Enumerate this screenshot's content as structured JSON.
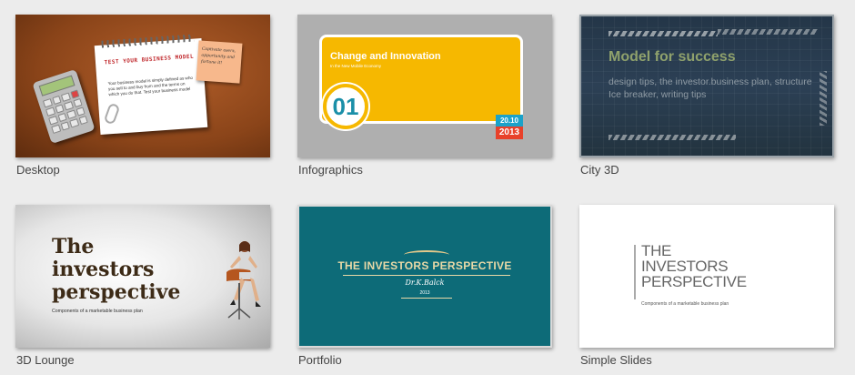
{
  "templates": [
    {
      "name": "Desktop",
      "notepad_title": "TEST YOUR BUSINESS MODEL",
      "notepad_body": "Your business model is simply defined as who you sell to and buy from and the terms on which you do that. Test your business model",
      "sticky_note": "Captivate users, opportunity and fortune it!"
    },
    {
      "name": "Infographics",
      "title": "Change and Innovation",
      "subtitle": "In the New Mobile Economy",
      "number": "01",
      "date": "20.10",
      "year": "2013",
      "colors": {
        "accent": "#f6b800",
        "number": "#1a8fa8",
        "date": "#1ba2c9",
        "year": "#e8412a"
      }
    },
    {
      "name": "City 3D",
      "title": "Model for success",
      "text": "design tips, the investor.business plan, structure Ice breaker, writing tips"
    },
    {
      "name": "3D Lounge",
      "title": "The investors perspective",
      "subtitle": "Components of a marketable business plan"
    },
    {
      "name": "Portfolio",
      "title": "THE INVESTORS PERSPECTIVE",
      "author": "Dr.K.Balck",
      "year": "2013"
    },
    {
      "name": "Simple Slides",
      "title": "THE INVESTORS PERSPECTIVE",
      "subtitle": "Components of a marketable business plan"
    }
  ]
}
